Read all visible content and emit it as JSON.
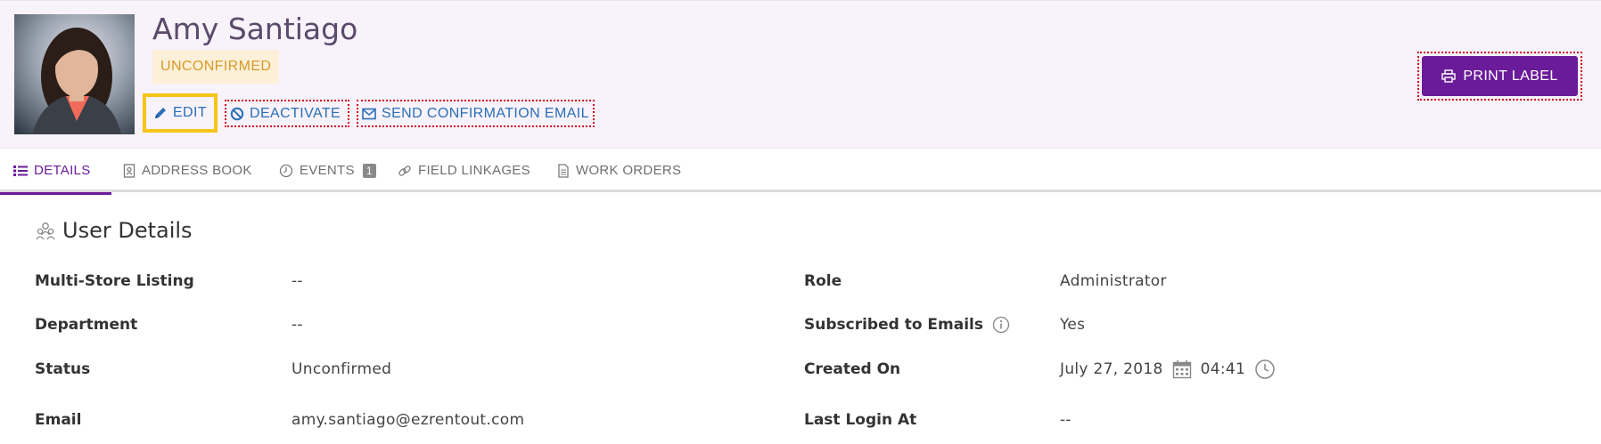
{
  "user": {
    "name": "Amy Santiago",
    "status_badge": "UNCONFIRMED"
  },
  "actions": {
    "edit": "EDIT",
    "deactivate": "DEACTIVATE",
    "send_confirmation": "SEND CONFIRMATION EMAIL",
    "print_label": "PRINT LABEL"
  },
  "tabs": [
    {
      "label": "DETAILS",
      "icon": "list-icon",
      "active": true
    },
    {
      "label": "ADDRESS BOOK",
      "icon": "address-book-icon"
    },
    {
      "label": "EVENTS",
      "icon": "clock-icon",
      "count": "1"
    },
    {
      "label": "FIELD LINKAGES",
      "icon": "link-icon"
    },
    {
      "label": "WORK ORDERS",
      "icon": "document-icon"
    }
  ],
  "section": {
    "title": "User Details",
    "icon": "users-icon"
  },
  "fields": {
    "multi_store_label": "Multi-Store Listing",
    "multi_store_value": "--",
    "department_label": "Department",
    "department_value": "--",
    "status_label": "Status",
    "status_value": "Unconfirmed",
    "email_label": "Email",
    "email_value": "amy.santiago@ezrentout.com",
    "role_label": "Role",
    "role_value": "Administrator",
    "subscribed_label": "Subscribed to Emails",
    "subscribed_value": "Yes",
    "created_label": "Created On",
    "created_date": "July 27, 2018",
    "created_time": "04:41",
    "last_login_label": "Last Login At",
    "last_login_value": "--"
  },
  "colors": {
    "accent": "#6a1b9a",
    "link": "#2a6fb7",
    "badge_bg": "#fdf0d8",
    "badge_text": "#d69a2a",
    "header_bg": "#f8f2fa"
  }
}
